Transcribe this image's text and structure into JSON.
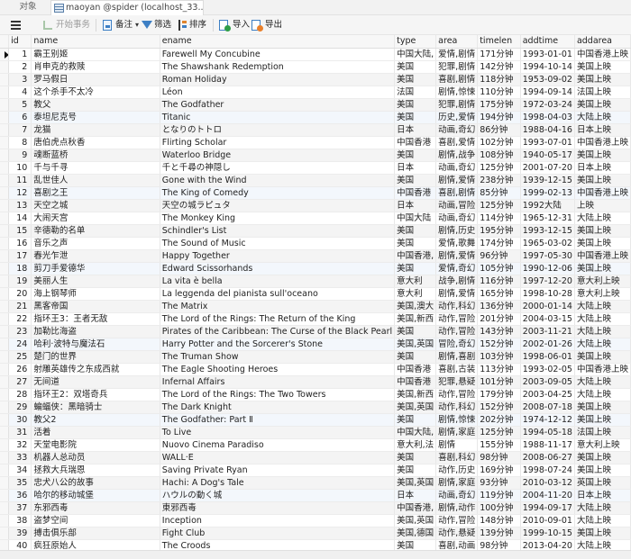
{
  "tabs": [
    {
      "label": "对象",
      "active": false
    },
    {
      "label": "maoyan @spider (localhost_33...",
      "icon": "table-icon",
      "active": true
    }
  ],
  "toolbar": {
    "menu_icon": "hamburger-menu-icon",
    "begin_transaction": "开始事务",
    "memo": "备注",
    "memo_dropdown": "▾",
    "filter": "筛选",
    "sort": "排序",
    "import": "导入",
    "export": "导出"
  },
  "table": {
    "columns": [
      "id",
      "name",
      "ename",
      "type",
      "area",
      "timelen",
      "addtime",
      "addarea"
    ],
    "current_row": 1,
    "rows": [
      {
        "id": "1",
        "name": "霸王别姬",
        "ename": "Farewell My Concubine",
        "type": "中国大陆,",
        "area": "爱情,剧情",
        "timelen": "171分钟",
        "addtime": "1993-01-01",
        "addarea": "中国香港上映"
      },
      {
        "id": "2",
        "name": "肖申克的救赎",
        "ename": "The Shawshank Redemption",
        "type": "美国",
        "area": "犯罪,剧情",
        "timelen": "142分钟",
        "addtime": "1994-10-14",
        "addarea": "美国上映"
      },
      {
        "id": "3",
        "name": "罗马假日",
        "ename": "Roman Holiday",
        "type": "美国",
        "area": "喜剧,剧情",
        "timelen": "118分钟",
        "addtime": "1953-09-02",
        "addarea": "美国上映"
      },
      {
        "id": "4",
        "name": "这个杀手不太冷",
        "ename": "Léon",
        "type": "法国",
        "area": "剧情,惊悚",
        "timelen": "110分钟",
        "addtime": "1994-09-14",
        "addarea": "法国上映"
      },
      {
        "id": "5",
        "name": "教父",
        "ename": "The Godfather",
        "type": "美国",
        "area": "犯罪,剧情",
        "timelen": "175分钟",
        "addtime": "1972-03-24",
        "addarea": "美国上映"
      },
      {
        "id": "6",
        "name": "泰坦尼克号",
        "ename": "Titanic",
        "type": "美国",
        "area": "历史,爱情",
        "timelen": "194分钟",
        "addtime": "1998-04-03",
        "addarea": "大陆上映"
      },
      {
        "id": "7",
        "name": "龙猫",
        "ename": "となりのトトロ",
        "type": "日本",
        "area": "动画,奇幻",
        "timelen": "86分钟",
        "addtime": "1988-04-16",
        "addarea": "日本上映"
      },
      {
        "id": "8",
        "name": "唐伯虎点秋香",
        "ename": "Flirting Scholar",
        "type": "中国香港",
        "area": "喜剧,爱情",
        "timelen": "102分钟",
        "addtime": "1993-07-01",
        "addarea": "中国香港上映"
      },
      {
        "id": "9",
        "name": "魂断蓝桥",
        "ename": "Waterloo Bridge",
        "type": "美国",
        "area": "剧情,战争",
        "timelen": "108分钟",
        "addtime": "1940-05-17",
        "addarea": "美国上映"
      },
      {
        "id": "10",
        "name": "千与千寻",
        "ename": "千と千尋の神隠し",
        "type": "日本",
        "area": "动画,奇幻",
        "timelen": "125分钟",
        "addtime": "2001-07-20",
        "addarea": "日本上映"
      },
      {
        "id": "11",
        "name": "乱世佳人",
        "ename": "Gone with the Wind",
        "type": "美国",
        "area": "剧情,爱情",
        "timelen": "238分钟",
        "addtime": "1939-12-15",
        "addarea": "美国上映"
      },
      {
        "id": "12",
        "name": "喜剧之王",
        "ename": "The King of Comedy",
        "type": "中国香港",
        "area": "喜剧,剧情",
        "timelen": "85分钟",
        "addtime": "1999-02-13",
        "addarea": "中国香港上映"
      },
      {
        "id": "13",
        "name": "天空之城",
        "ename": "天空の城ラピュタ",
        "type": "日本",
        "area": "动画,冒险",
        "timelen": "125分钟",
        "addtime": "1992大陆",
        "addarea": "上映"
      },
      {
        "id": "14",
        "name": "大闹天宫",
        "ename": "The Monkey King",
        "type": "中国大陆",
        "area": "动画,奇幻",
        "timelen": "114分钟",
        "addtime": "1965-12-31",
        "addarea": "大陆上映"
      },
      {
        "id": "15",
        "name": "辛德勒的名单",
        "ename": "Schindler's List",
        "type": "美国",
        "area": "剧情,历史",
        "timelen": "195分钟",
        "addtime": "1993-12-15",
        "addarea": "美国上映"
      },
      {
        "id": "16",
        "name": "音乐之声",
        "ename": "The Sound of Music",
        "type": "美国",
        "area": "爱情,歌舞",
        "timelen": "174分钟",
        "addtime": "1965-03-02",
        "addarea": "美国上映"
      },
      {
        "id": "17",
        "name": "春光乍泄",
        "ename": "Happy Together",
        "type": "中国香港,",
        "area": "剧情,爱情",
        "timelen": "96分钟",
        "addtime": "1997-05-30",
        "addarea": "中国香港上映"
      },
      {
        "id": "18",
        "name": "剪刀手爱德华",
        "ename": "Edward Scissorhands",
        "type": "美国",
        "area": "爱情,奇幻",
        "timelen": "105分钟",
        "addtime": "1990-12-06",
        "addarea": "美国上映"
      },
      {
        "id": "19",
        "name": "美丽人生",
        "ename": "La vita è bella",
        "type": "意大利",
        "area": "战争,剧情",
        "timelen": "116分钟",
        "addtime": "1997-12-20",
        "addarea": "意大利上映"
      },
      {
        "id": "20",
        "name": "海上钢琴师",
        "ename": "La leggenda del pianista sull'oceano",
        "type": "意大利",
        "area": "剧情,爱情",
        "timelen": "165分钟",
        "addtime": "1998-10-28",
        "addarea": "意大利上映"
      },
      {
        "id": "21",
        "name": "黑客帝国",
        "ename": "The Matrix",
        "type": "美国,澳大",
        "area": "动作,科幻",
        "timelen": "136分钟",
        "addtime": "2000-01-14",
        "addarea": "大陆上映"
      },
      {
        "id": "22",
        "name": "指环王3：王者无敌",
        "ename": "The Lord of the Rings: The Return of the King",
        "type": "美国,新西",
        "area": "动作,冒险",
        "timelen": "201分钟",
        "addtime": "2004-03-15",
        "addarea": "大陆上映"
      },
      {
        "id": "23",
        "name": "加勒比海盗",
        "ename": "Pirates of the Caribbean: The Curse of the Black Pearl",
        "type": "美国",
        "area": "动作,冒险",
        "timelen": "143分钟",
        "addtime": "2003-11-21",
        "addarea": "大陆上映"
      },
      {
        "id": "24",
        "name": "哈利·波特与魔法石",
        "ename": "Harry Potter and the Sorcerer's Stone",
        "type": "美国,英国",
        "area": "冒险,奇幻",
        "timelen": "152分钟",
        "addtime": "2002-01-26",
        "addarea": "大陆上映"
      },
      {
        "id": "25",
        "name": "楚门的世界",
        "ename": "The Truman Show",
        "type": "美国",
        "area": "剧情,喜剧",
        "timelen": "103分钟",
        "addtime": "1998-06-01",
        "addarea": "美国上映"
      },
      {
        "id": "26",
        "name": "射雕英雄传之东成西就",
        "ename": "The Eagle Shooting Heroes",
        "type": "中国香港",
        "area": "喜剧,古装",
        "timelen": "113分钟",
        "addtime": "1993-02-05",
        "addarea": "中国香港上映"
      },
      {
        "id": "27",
        "name": "无间道",
        "ename": "Infernal Affairs",
        "type": "中国香港",
        "area": "犯罪,悬疑",
        "timelen": "101分钟",
        "addtime": "2003-09-05",
        "addarea": "大陆上映"
      },
      {
        "id": "28",
        "name": "指环王2：双塔奇兵",
        "ename": "The Lord of the Rings: The Two Towers",
        "type": "美国,新西",
        "area": "动作,冒险",
        "timelen": "179分钟",
        "addtime": "2003-04-25",
        "addarea": "大陆上映"
      },
      {
        "id": "29",
        "name": "蝙蝠侠：黑暗骑士",
        "ename": "The Dark Knight",
        "type": "美国,英国",
        "area": "动作,科幻",
        "timelen": "152分钟",
        "addtime": "2008-07-18",
        "addarea": "美国上映"
      },
      {
        "id": "30",
        "name": "教父2",
        "ename": "The Godfather: Part Ⅱ",
        "type": "美国",
        "area": "剧情,惊悚",
        "timelen": "202分钟",
        "addtime": "1974-12-12",
        "addarea": "美国上映"
      },
      {
        "id": "31",
        "name": "活着",
        "ename": "To Live",
        "type": "中国大陆,",
        "area": "剧情,家庭",
        "timelen": "125分钟",
        "addtime": "1994-05-18",
        "addarea": "法国上映"
      },
      {
        "id": "32",
        "name": "天堂电影院",
        "ename": "Nuovo Cinema Paradiso",
        "type": "意大利,法",
        "area": "剧情",
        "timelen": "155分钟",
        "addtime": "1988-11-17",
        "addarea": "意大利上映"
      },
      {
        "id": "33",
        "name": "机器人总动员",
        "ename": "WALL·E",
        "type": "美国",
        "area": "喜剧,科幻",
        "timelen": "98分钟",
        "addtime": "2008-06-27",
        "addarea": "美国上映"
      },
      {
        "id": "34",
        "name": "拯救大兵瑞恩",
        "ename": "Saving Private Ryan",
        "type": "美国",
        "area": "动作,历史",
        "timelen": "169分钟",
        "addtime": "1998-07-24",
        "addarea": "美国上映"
      },
      {
        "id": "35",
        "name": "忠犬八公的故事",
        "ename": "Hachi: A Dog's Tale",
        "type": "美国,英国",
        "area": "剧情,家庭",
        "timelen": "93分钟",
        "addtime": "2010-03-12",
        "addarea": "英国上映"
      },
      {
        "id": "36",
        "name": "哈尔的移动城堡",
        "ename": "ハウルの動く城",
        "type": "日本",
        "area": "动画,奇幻",
        "timelen": "119分钟",
        "addtime": "2004-11-20",
        "addarea": "日本上映"
      },
      {
        "id": "37",
        "name": "东邪西毒",
        "ename": "東邪西毒",
        "type": "中国香港,",
        "area": "剧情,动作",
        "timelen": "100分钟",
        "addtime": "1994-09-17",
        "addarea": "大陆上映"
      },
      {
        "id": "38",
        "name": "盗梦空间",
        "ename": "Inception",
        "type": "美国,英国",
        "area": "动作,冒险",
        "timelen": "148分钟",
        "addtime": "2010-09-01",
        "addarea": "大陆上映"
      },
      {
        "id": "39",
        "name": "搏击俱乐部",
        "ename": "Fight Club",
        "type": "美国,德国",
        "area": "动作,悬疑",
        "timelen": "139分钟",
        "addtime": "1999-10-15",
        "addarea": "美国上映"
      },
      {
        "id": "40",
        "name": "疯狂原始人",
        "ename": "The Croods",
        "type": "美国",
        "area": "喜剧,动画",
        "timelen": "98分钟",
        "addtime": "2013-04-20",
        "addarea": "大陆上映"
      }
    ]
  }
}
